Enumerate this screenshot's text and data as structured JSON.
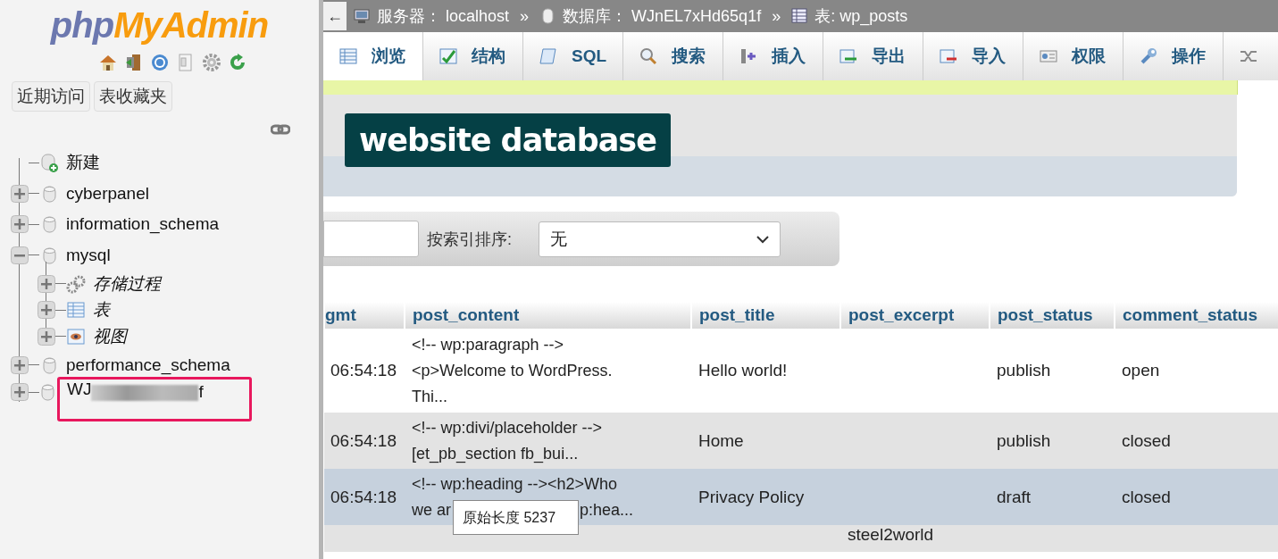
{
  "sidebar": {
    "logo": {
      "part1": "php",
      "part2": "MyAdmin"
    },
    "buttons": [
      {
        "label": "近期访问"
      },
      {
        "label": "表收藏夹"
      }
    ],
    "tree": [
      {
        "label": "新建",
        "kind": "new"
      },
      {
        "label": "cyberpanel",
        "kind": "database",
        "expanded": false
      },
      {
        "label": "information_schema",
        "kind": "database",
        "expanded": false
      },
      {
        "label": "mysql",
        "kind": "database",
        "expanded": true,
        "children": [
          {
            "label": "存储过程",
            "kind": "procedures",
            "expanded": false
          },
          {
            "label": "表",
            "kind": "tables",
            "expanded": false
          },
          {
            "label": "视图",
            "kind": "views",
            "expanded": false
          }
        ]
      },
      {
        "label": "performance_schema",
        "kind": "database",
        "expanded": false
      },
      {
        "label_start": "WJ",
        "label_end": "f",
        "kind": "database",
        "expanded": false,
        "redacted": true,
        "highlighted": true
      }
    ]
  },
  "breadcrumb": {
    "back": "←",
    "items": [
      {
        "kind": "server",
        "label": "服务器：",
        "value": "localhost"
      },
      {
        "kind": "database",
        "label": "数据库：",
        "value": "WJnEL7xHd65q1f"
      },
      {
        "kind": "table",
        "label": "表:",
        "value": "wp_posts"
      }
    ],
    "separator": "»"
  },
  "tabs": [
    {
      "label": "浏览",
      "selected": true
    },
    {
      "label": "结构",
      "selected": false
    },
    {
      "label": "SQL",
      "selected": false
    },
    {
      "label": "搜索",
      "selected": false
    },
    {
      "label": "插入",
      "selected": false
    },
    {
      "label": "导出",
      "selected": false
    },
    {
      "label": "导入",
      "selected": false
    },
    {
      "label": "权限",
      "selected": false
    },
    {
      "label": "操作",
      "selected": false
    },
    {
      "selected": false
    }
  ],
  "banner": "website database",
  "sort_bar": {
    "label": "按索引排序:",
    "select_value": "无"
  },
  "table": {
    "columns": [
      "gmt",
      "post_content",
      "post_title",
      "post_excerpt",
      "post_status",
      "comment_status"
    ],
    "rows": [
      {
        "selected": false,
        "gmt": "06:54:18",
        "post_content": [
          "<!-- wp:paragraph -->",
          "<p>Welcome to WordPress.",
          "Thi..."
        ],
        "post_title": "Hello world!",
        "post_status": "publish",
        "comment_status": "open"
      },
      {
        "selected": false,
        "gmt": "06:54:18",
        "post_content": [
          "<!-- wp:divi/placeholder -->",
          "[et_pb_section fb_bui..."
        ],
        "post_title": "Home",
        "post_status": "publish",
        "comment_status": "closed"
      },
      {
        "selected": true,
        "gmt": "06:54:18",
        "post_content": [
          "<!-- wp:heading --><h2>Who",
          [
            "we ar",
            "p:hea..."
          ]
        ],
        "post_title": "Privacy Policy",
        "post_status": "draft",
        "comment_status": "closed",
        "tooltip": "原始长度 5237"
      },
      {
        "selected": false,
        "post_excerpt": "steel2world"
      }
    ]
  }
}
